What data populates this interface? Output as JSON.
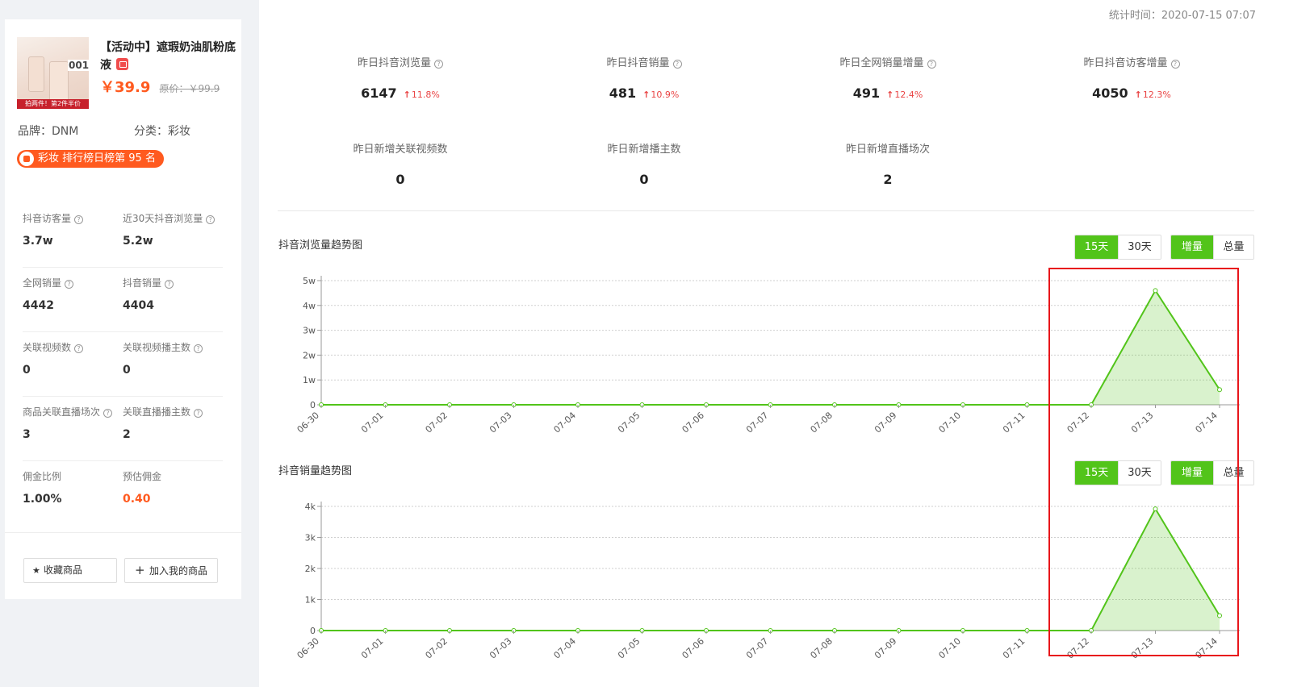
{
  "product": {
    "title": "【活动中】遮瑕奶油肌粉底液",
    "price": "￥39.9",
    "original_price": "原价：￥99.9",
    "image_label": "001",
    "image_promo": "拍两件！第2件半价",
    "brand": "品牌：DNM",
    "category": "分类：彩妆",
    "rank": "彩妆 排行榜日榜第 95 名"
  },
  "left_stats": [
    {
      "label": "抖音访客量",
      "value": "3.7w",
      "help": true
    },
    {
      "label": "近30天抖音浏览量",
      "value": "5.2w",
      "help": true
    },
    {
      "label": "全网销量",
      "value": "4442",
      "help": true
    },
    {
      "label": "抖音销量",
      "value": "4404",
      "help": true
    },
    {
      "label": "关联视频数",
      "value": "0",
      "help": true
    },
    {
      "label": "关联视频播主数",
      "value": "0",
      "help": true
    },
    {
      "label": "商品关联直播场次",
      "value": "3",
      "help": true
    },
    {
      "label": "关联直播播主数",
      "value": "2",
      "help": true
    },
    {
      "label": "佣金比例",
      "value": "1.00%",
      "help": false
    },
    {
      "label": "预估佣金",
      "value": "0.40",
      "help": false,
      "highlight": true
    }
  ],
  "actions": {
    "favorite": "收藏商品",
    "add_mine": "加入我的商品"
  },
  "stat_time": "统计时间：2020-07-15 07:07",
  "kpis": [
    {
      "label": "昨日抖音浏览量",
      "value": "6147",
      "change": "11.8%",
      "help": true
    },
    {
      "label": "昨日抖音销量",
      "value": "481",
      "change": "10.9%",
      "help": true
    },
    {
      "label": "昨日全网销量增量",
      "value": "491",
      "change": "12.4%",
      "help": true
    },
    {
      "label": "昨日抖音访客增量",
      "value": "4050",
      "change": "12.3%",
      "help": true
    },
    {
      "label": "昨日新增关联视频数",
      "value": "0",
      "change": "",
      "help": false
    },
    {
      "label": "昨日新增播主数",
      "value": "0",
      "change": "",
      "help": false
    },
    {
      "label": "昨日新增直播场次",
      "value": "2",
      "change": "",
      "help": false
    }
  ],
  "toggles": {
    "days15": "15天",
    "days30": "30天",
    "increment": "增量",
    "total": "总量"
  },
  "colors": {
    "accent_green": "#52c41a",
    "price_orange": "#ff5a1f",
    "up_red": "#e94444",
    "highlight_red": "#e8161b"
  },
  "chart_data": [
    {
      "type": "area",
      "title": "抖音浏览量趋势图",
      "categories": [
        "06-30",
        "07-01",
        "07-02",
        "07-03",
        "07-04",
        "07-05",
        "07-06",
        "07-07",
        "07-08",
        "07-09",
        "07-10",
        "07-11",
        "07-12",
        "07-13",
        "07-14"
      ],
      "values": [
        0,
        0,
        0,
        0,
        0,
        0,
        0,
        0,
        0,
        0,
        0,
        0,
        0,
        46000,
        6100
      ],
      "yticks": [
        "0",
        "1w",
        "2w",
        "3w",
        "4w",
        "5w"
      ],
      "ylim": [
        0,
        50000
      ]
    },
    {
      "type": "area",
      "title": "抖音销量趋势图",
      "categories": [
        "06-30",
        "07-01",
        "07-02",
        "07-03",
        "07-04",
        "07-05",
        "07-06",
        "07-07",
        "07-08",
        "07-09",
        "07-10",
        "07-11",
        "07-12",
        "07-13",
        "07-14"
      ],
      "values": [
        0,
        0,
        0,
        0,
        0,
        0,
        0,
        0,
        0,
        0,
        0,
        0,
        0,
        3920,
        481
      ],
      "yticks": [
        "0",
        "1k",
        "2k",
        "3k",
        "4k"
      ],
      "ylim": [
        0,
        4000
      ]
    }
  ]
}
